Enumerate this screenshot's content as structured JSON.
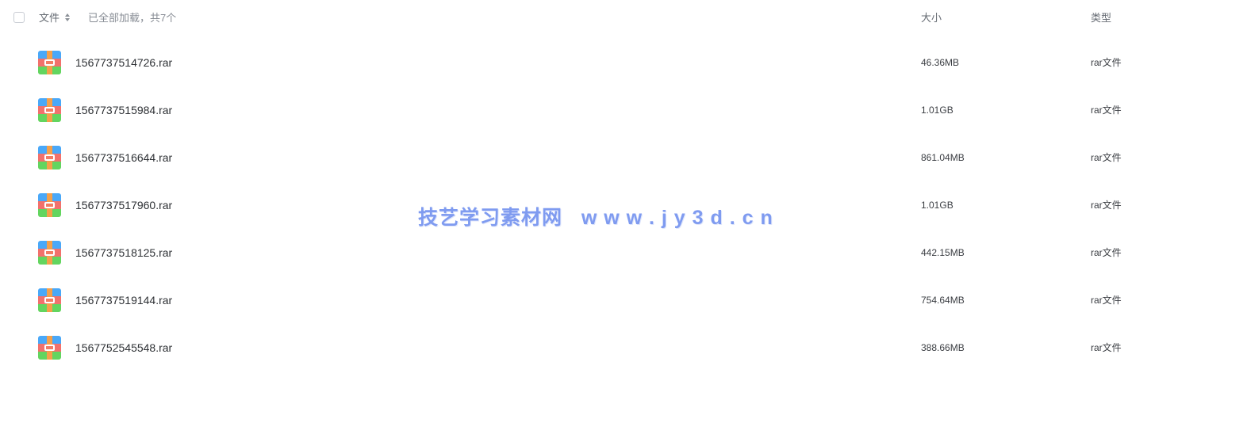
{
  "header": {
    "select_all": false,
    "name_label": "文件",
    "loaded_status": "已全部加载，共7个",
    "size_label": "大小",
    "type_label": "类型"
  },
  "files": [
    {
      "name": "1567737514726.rar",
      "size": "46.36MB",
      "type": "rar文件",
      "icon": "archive-icon"
    },
    {
      "name": "1567737515984.rar",
      "size": "1.01GB",
      "type": "rar文件",
      "icon": "archive-icon"
    },
    {
      "name": "1567737516644.rar",
      "size": "861.04MB",
      "type": "rar文件",
      "icon": "archive-icon"
    },
    {
      "name": "1567737517960.rar",
      "size": "1.01GB",
      "type": "rar文件",
      "icon": "archive-icon"
    },
    {
      "name": "1567737518125.rar",
      "size": "442.15MB",
      "type": "rar文件",
      "icon": "archive-icon"
    },
    {
      "name": "1567737519144.rar",
      "size": "754.64MB",
      "type": "rar文件",
      "icon": "archive-icon"
    },
    {
      "name": "1567752545548.rar",
      "size": "388.66MB",
      "type": "rar文件",
      "icon": "archive-icon"
    }
  ],
  "watermark": "技艺学习素材网   w w w . j y 3 d . c n",
  "colors": {
    "watermark": "#7f9bf0",
    "icon_blue": "#4aa8f8",
    "icon_red": "#f2716c",
    "icon_green": "#63d55f",
    "icon_strap": "#f5a04a"
  }
}
